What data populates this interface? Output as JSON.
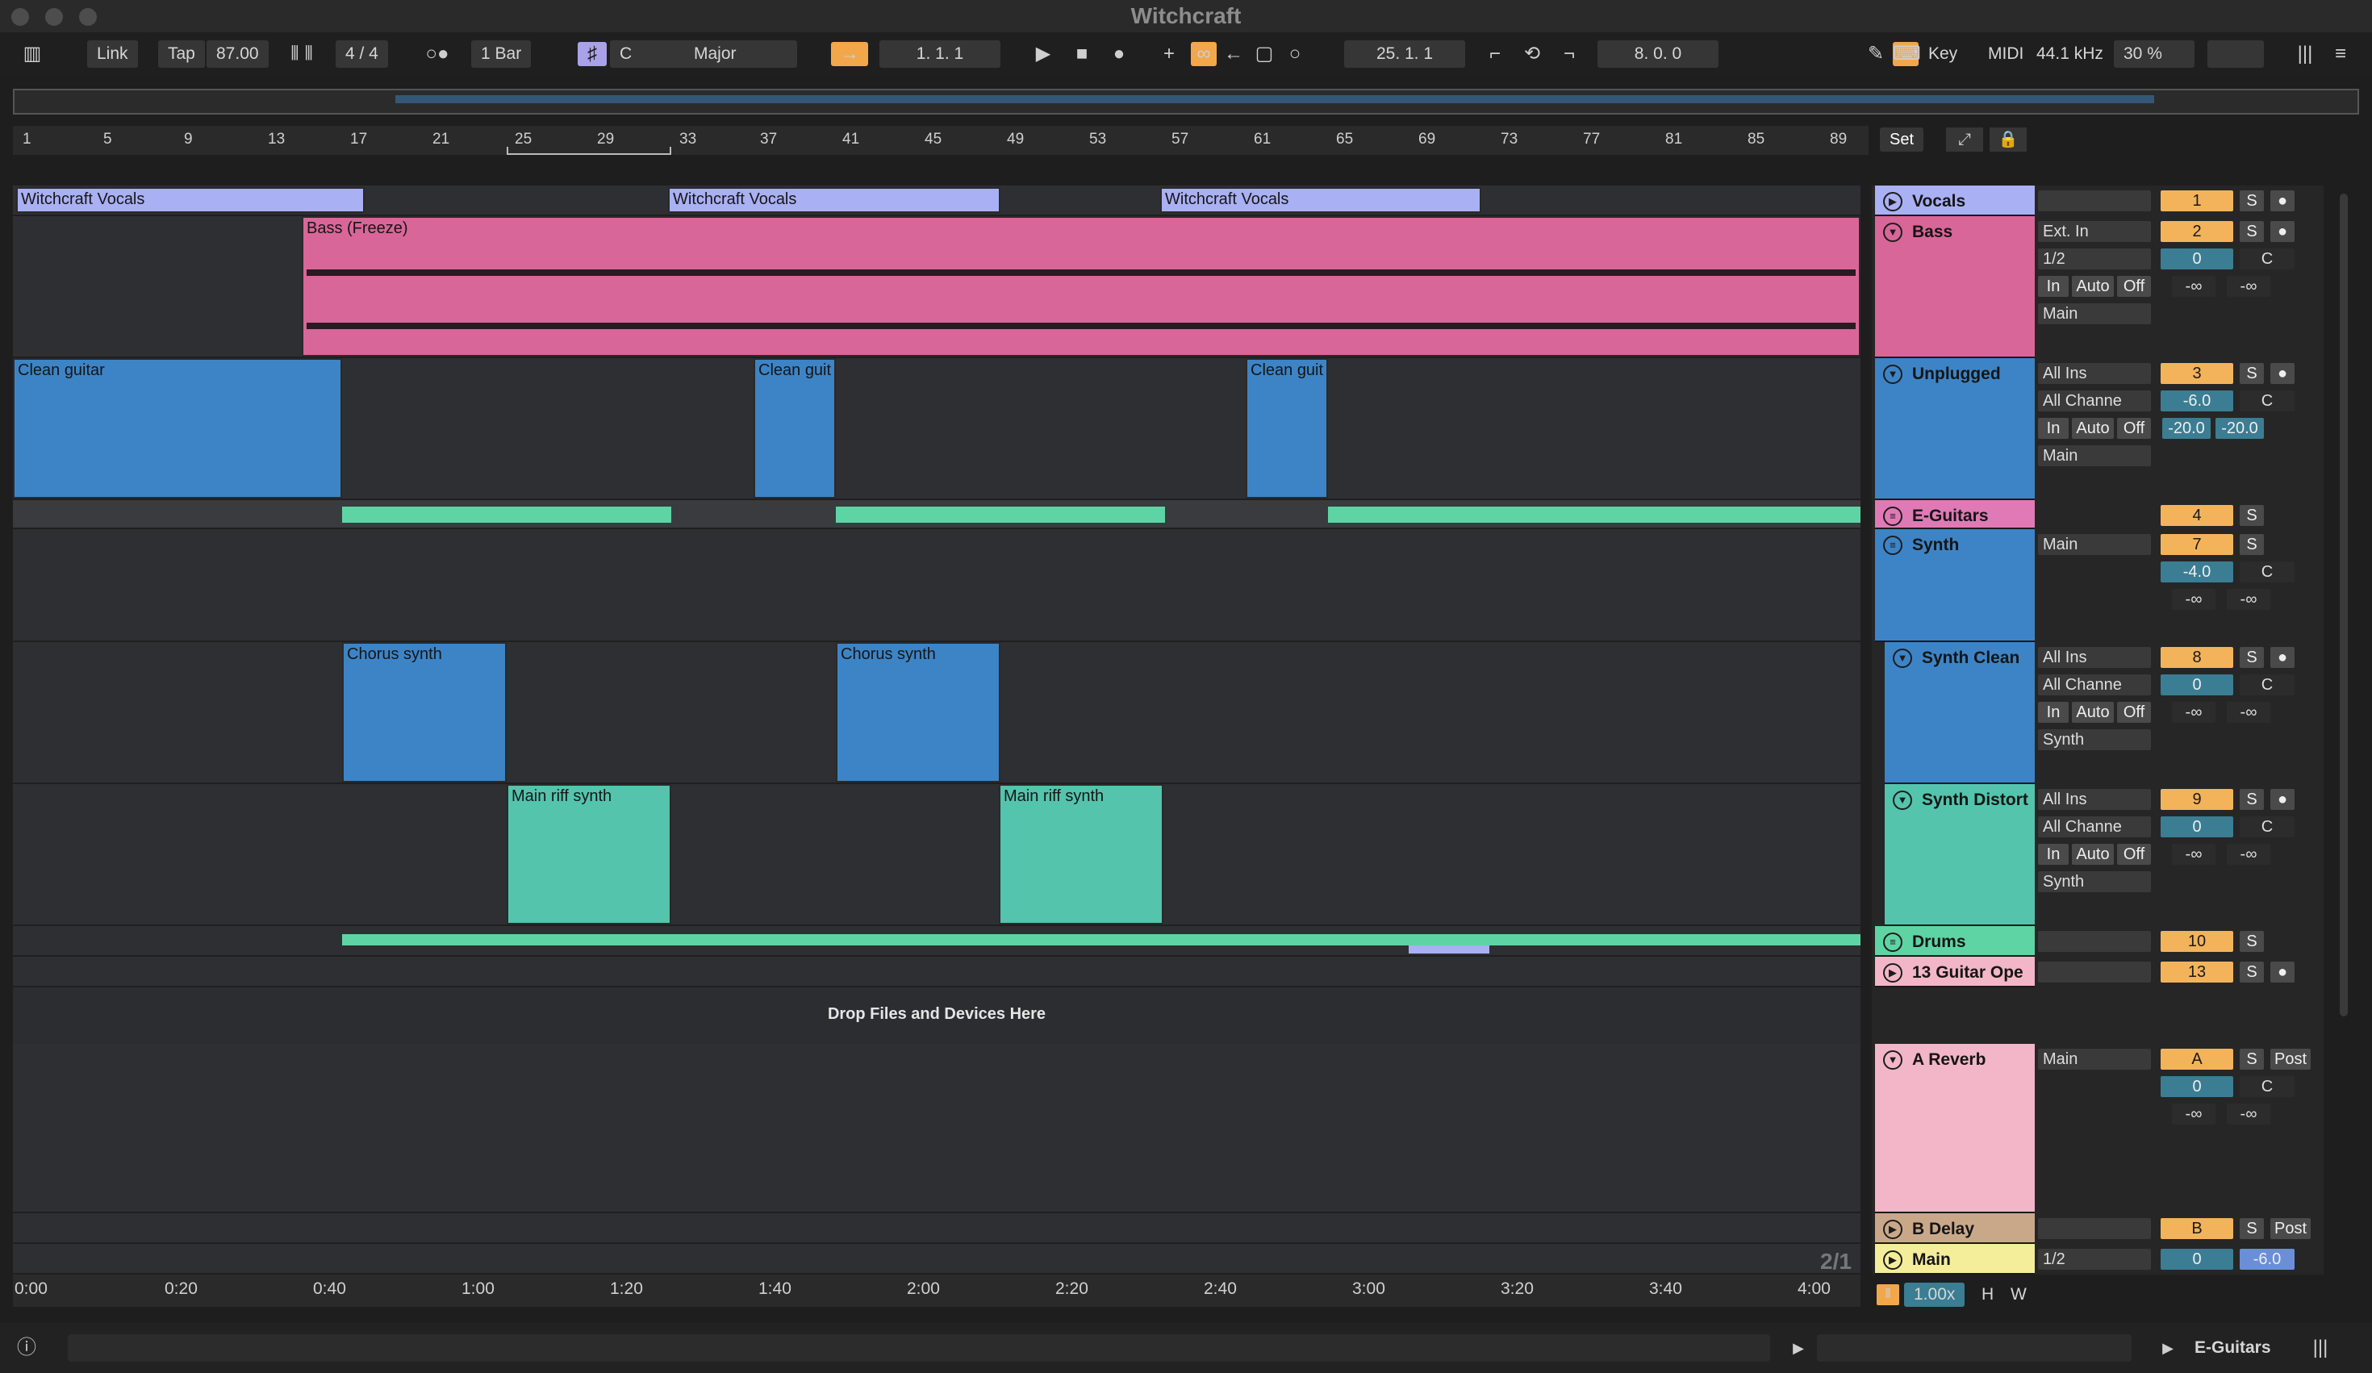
{
  "title": "Witchcraft",
  "control_bar": {
    "link": "Link",
    "tap": "Tap",
    "tempo": "87.00",
    "time_sig": "4 / 4",
    "quantize": "1 Bar",
    "key": "C",
    "scale": "Major",
    "arrangement_position": "1.  1.  1",
    "loop_start": "25.  1.  1",
    "loop_length": "8.  0.  0",
    "key_map": "Key",
    "midi_map": "MIDI",
    "sample_rate": "44.1 kHz",
    "cpu": "30 %"
  },
  "ruler_bars": [
    "1",
    "5",
    "9",
    "13",
    "17",
    "21",
    "25",
    "29",
    "33",
    "37",
    "41",
    "45",
    "49",
    "53",
    "57",
    "61",
    "65",
    "69",
    "73",
    "77",
    "81",
    "85",
    "89"
  ],
  "ruler_buttons": {
    "set": "Set"
  },
  "time_marks": [
    "0:00",
    "0:20",
    "0:40",
    "1:00",
    "1:20",
    "1:40",
    "2:00",
    "2:20",
    "2:40",
    "3:00",
    "3:20",
    "3:40",
    "4:00"
  ],
  "clips": {
    "vocals": [
      "Witchcraft Vocals",
      "Witchcraft Vocals",
      "Witchcraft Vocals"
    ],
    "bass": "Bass (Freeze)",
    "clean": [
      "Clean guitar",
      "Clean guit",
      "Clean guit"
    ],
    "chorus": [
      "Chorus synth",
      "Chorus synth"
    ],
    "riff": [
      "Main riff synth",
      "Main riff synth"
    ]
  },
  "drop_text": "Drop Files and Devices Here",
  "tracks": [
    {
      "name": "Vocals",
      "num": "1",
      "s": "S"
    },
    {
      "name": "Bass",
      "num": "2",
      "s": "S",
      "input": "Ext. In",
      "channel": "1/2",
      "vol": "0",
      "pan": "C",
      "mon_in": "In",
      "mon_auto": "Auto",
      "mon_off": "Off",
      "out": "Main",
      "send_a": "-∞",
      "send_b": "-∞"
    },
    {
      "name": "Unplugged",
      "num": "3",
      "s": "S",
      "input": "All Ins",
      "channel": "All Channe",
      "vol": "-6.0",
      "pan": "C",
      "mon_in": "In",
      "mon_auto": "Auto",
      "mon_off": "Off",
      "out": "Main",
      "send_a": "-20.0",
      "send_b": "-20.0"
    },
    {
      "name": "E-Guitars",
      "num": "4",
      "s": "S"
    },
    {
      "name": "Synth",
      "num": "7",
      "s": "S",
      "out": "Main",
      "vol": "-4.0",
      "pan": "C",
      "send_a": "-∞",
      "send_b": "-∞"
    },
    {
      "name": "Synth Clean",
      "num": "8",
      "s": "S",
      "input": "All Ins",
      "channel": "All Channe",
      "vol": "0",
      "pan": "C",
      "mon_in": "In",
      "mon_auto": "Auto",
      "mon_off": "Off",
      "out": "Synth",
      "send_a": "-∞",
      "send_b": "-∞"
    },
    {
      "name": "Synth Distort",
      "num": "9",
      "s": "S",
      "input": "All Ins",
      "channel": "All Channe",
      "vol": "0",
      "pan": "C",
      "mon_in": "In",
      "mon_auto": "Auto",
      "mon_off": "Off",
      "out": "Synth",
      "send_a": "-∞",
      "send_b": "-∞"
    },
    {
      "name": "Drums",
      "num": "10",
      "s": "S"
    },
    {
      "name": "13 Guitar Ope",
      "num": "13",
      "s": "S"
    },
    {
      "name": "A Reverb",
      "num": "A",
      "s": "S",
      "post": "Post",
      "out": "Main",
      "vol": "0",
      "pan": "C",
      "send_a": "-∞",
      "send_b": "-∞"
    },
    {
      "name": "B Delay",
      "num": "B",
      "s": "S",
      "post": "Post"
    },
    {
      "name": "Main",
      "channel": "1/2",
      "vol": "0",
      "vol2": "-6.0"
    }
  ],
  "page_indicator": "2/1",
  "zoom": "1.00x",
  "h_button": "H",
  "w_button": "W",
  "status_track": "E-Guitars",
  "colors": {
    "vocals": "#a9b0f3",
    "bass": "#d96698",
    "blue": "#3d84c6",
    "teal": "#54c4ad",
    "green": "#5ed4a4",
    "orange": "#f2a74b",
    "pink": "#f2b6c8",
    "main": "#f4ee9a",
    "delay": "#c9a88a"
  }
}
